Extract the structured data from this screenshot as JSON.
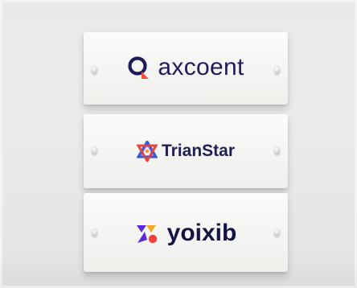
{
  "signs": [
    {
      "brand": "axcoent",
      "icon": "axcoent-logo-icon"
    },
    {
      "brand": "TrianStar",
      "icon": "trianstar-logo-icon"
    },
    {
      "brand": "yoixib",
      "icon": "yoixib-logo-icon"
    }
  ],
  "colors": {
    "wall": "#e9e9e7",
    "sign": "#f6f6f4",
    "text_navy": "#1e1c58",
    "axcoent_ring": "#1e1c58",
    "axcoent_accent": "#f0513a",
    "trianstar_red": "#e8473a",
    "trianstar_blue": "#2f5bd6",
    "trianstar_purple": "#7a3fc4",
    "trianstar_orange": "#f39a2e",
    "yoixib_purple": "#5b2bd9",
    "yoixib_orange": "#f6a623",
    "yoixib_red": "#f0433f"
  }
}
